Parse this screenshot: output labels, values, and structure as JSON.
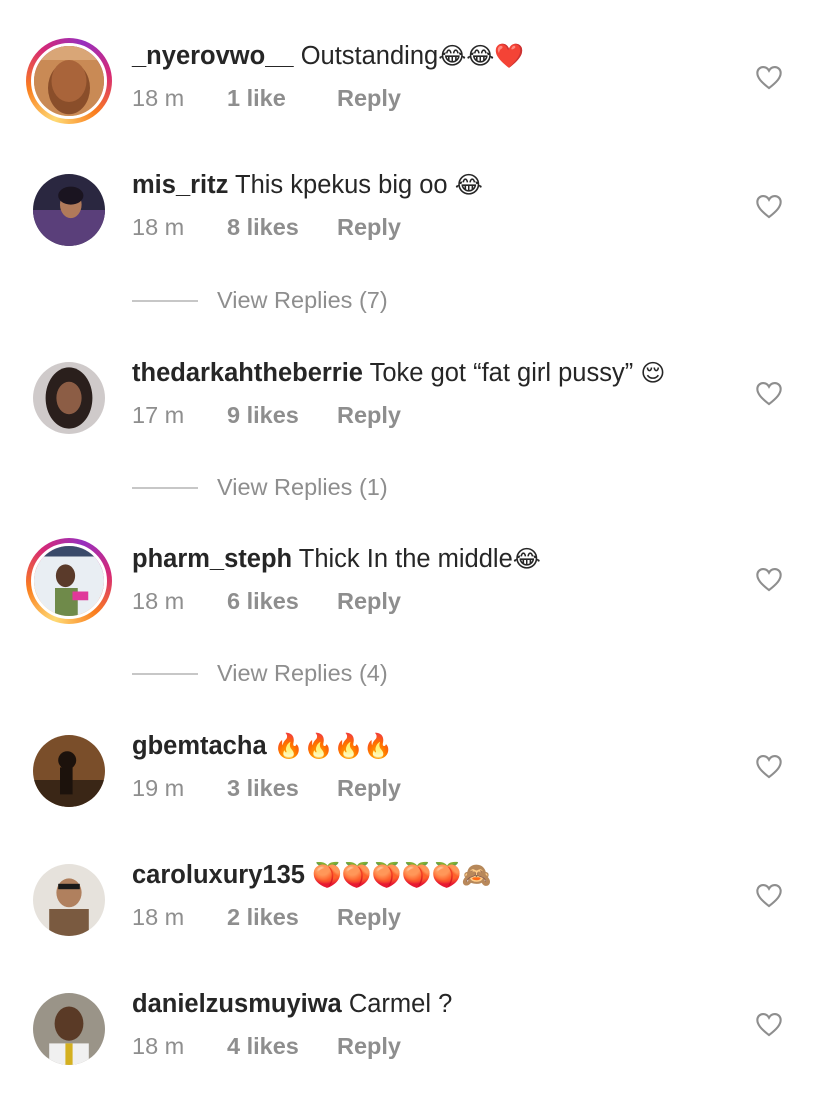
{
  "comments": [
    {
      "username": "_nyerovwo__",
      "text": "Outstanding",
      "emoji": "😂😂❤️",
      "time": "18 m",
      "likes": "1 like",
      "reply": "Reply",
      "story": true
    },
    {
      "username": "mis_ritz",
      "text": "This kpekus big oo",
      "emoji": "😂",
      "time": "18 m",
      "likes": "8 likes",
      "reply": "Reply",
      "story": false
    },
    {
      "username": "thedarkahtheberrie",
      "text": "Toke got “fat girl pussy”",
      "emoji": "😌",
      "time": "17 m",
      "likes": "9 likes",
      "reply": "Reply",
      "story": false
    },
    {
      "username": "pharm_steph",
      "text": "Thick In the middle",
      "emoji": "😂",
      "time": "18 m",
      "likes": "6 likes",
      "reply": "Reply",
      "story": true
    },
    {
      "username": "gbemtacha",
      "text": "",
      "emoji": "🔥🔥🔥🔥",
      "time": "19 m",
      "likes": "3 likes",
      "reply": "Reply",
      "story": false
    },
    {
      "username": "caroluxury135",
      "text": "",
      "emoji": "🍑🍑🍑🍑🍑🙈",
      "time": "18 m",
      "likes": "2 likes",
      "reply": "Reply",
      "story": false
    },
    {
      "username": "danielzusmuyiwa",
      "text": "Carmel ?",
      "emoji": "",
      "time": "18 m",
      "likes": "4 likes",
      "reply": "Reply",
      "story": false
    }
  ],
  "view_replies": [
    {
      "label": "View Replies (7)"
    },
    {
      "label": "View Replies (1)"
    },
    {
      "label": "View Replies (4)"
    }
  ],
  "colors": {
    "text": "#262626",
    "meta": "#8e8e8e",
    "divider": "#c7c7c7"
  }
}
